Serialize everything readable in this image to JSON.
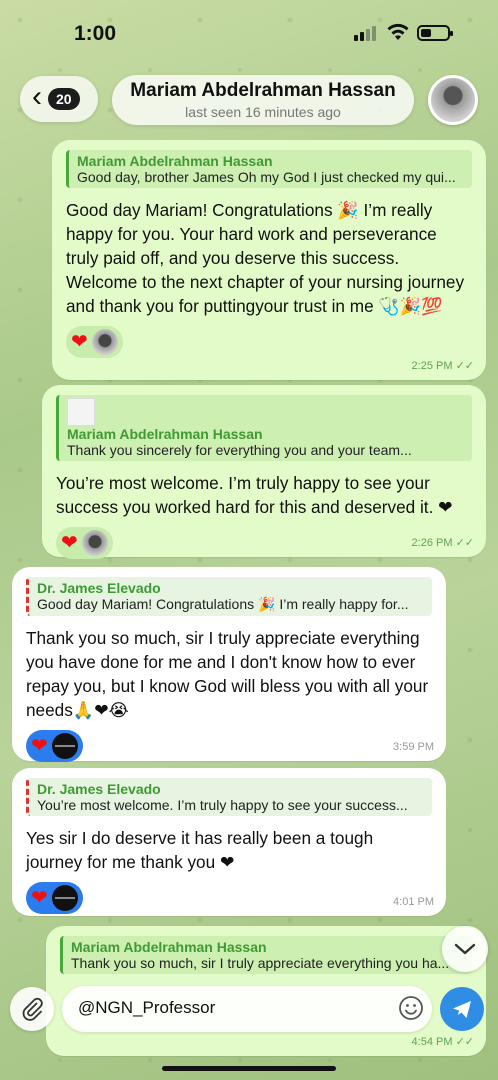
{
  "status": {
    "time": "1:00"
  },
  "header": {
    "back_count": "20",
    "chat_name": "Mariam Abdelrahman Hassan",
    "last_seen": "last seen 16 minutes ago"
  },
  "messages": [
    {
      "direction": "out",
      "reply_name": "Mariam Abdelrahman Hassan",
      "reply_text": "Good day, brother James Oh my God I just checked my qui...",
      "text": "Good day Mariam! Congratulations 🎉 I’m really happy for you. Your hard work and perseverance truly paid off, and you deserve this success. Welcome to the next chapter of your nursing journey and thank you for puttingyour trust in me 🩺🎉💯",
      "time": "2:25 PM",
      "reaction": "❤"
    },
    {
      "direction": "out",
      "reply_name": "Mariam Abdelrahman Hassan",
      "reply_text": "Thank you sincerely for everything you and your team...",
      "text": "You’re most welcome. I’m truly happy to see your success you worked hard for this and deserved it. ❤",
      "time": "2:26 PM",
      "reaction": "❤"
    },
    {
      "direction": "in",
      "reply_name": "Dr. James Elevado",
      "reply_text": "Good day Mariam! Congratulations 🎉 I’m really happy for...",
      "text": "Thank you so much, sir I truly appreciate everything you have done for me and I don't know how to ever repay you, but I know God will bless you with all your needs🙏❤😭",
      "time": "3:59 PM",
      "reaction": "❤"
    },
    {
      "direction": "in",
      "reply_name": "Dr. James Elevado",
      "reply_text": "You’re most welcome. I’m truly happy to see your success...",
      "text": "Yes sir I do deserve it has really been a tough journey for me thank you ❤",
      "time": "4:01 PM",
      "reaction": "❤"
    },
    {
      "direction": "out",
      "reply_name": "Mariam Abdelrahman Hassan",
      "reply_text": "Thank you so much, sir I truly appreciate everything you ha...",
      "time": "4:54 PM"
    }
  ],
  "input": {
    "value": "@NGN_Professor"
  },
  "icons": {
    "back": "chevron-left-icon",
    "attach": "paperclip-icon",
    "sticker": "smiley-icon",
    "send": "send-icon",
    "scroll": "chevron-down-icon"
  },
  "colors": {
    "outgoing": "#e3fbc8",
    "incoming": "#ffffff",
    "accent": "#2f8de4",
    "reply_name": "#3f9a33"
  }
}
